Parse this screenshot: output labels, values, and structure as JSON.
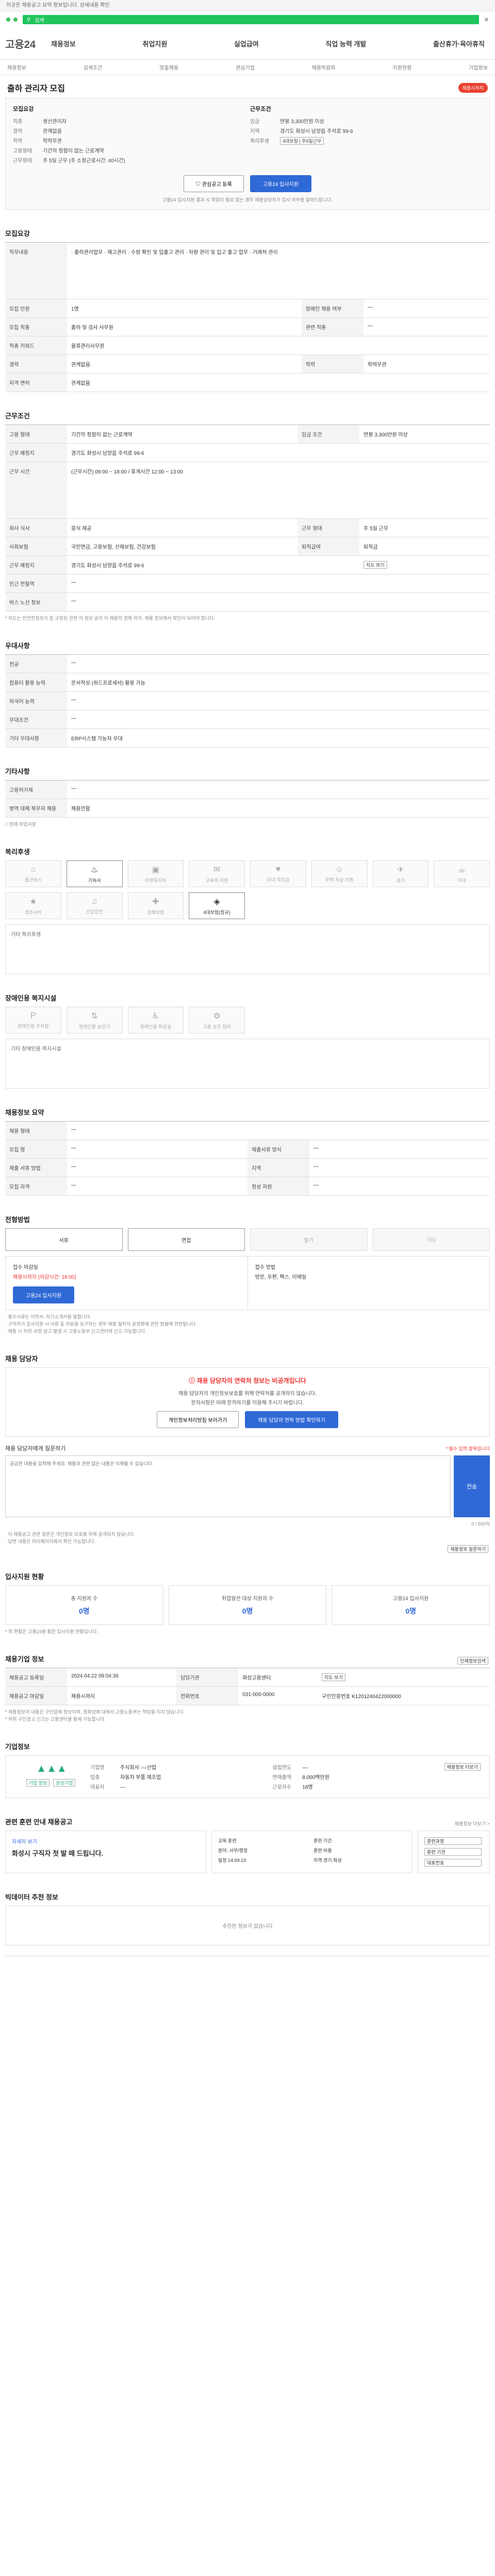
{
  "topbar": {
    "notice": "이곳은 채용공고 요약 정보입니다. 상세내용 확인"
  },
  "search": {
    "label": "검색",
    "close": "✕"
  },
  "header": {
    "logo": "고용24",
    "nav": [
      "채용정보",
      "취업지원",
      "실업급여",
      "직업 능력 개발",
      "출산휴가·육아휴직"
    ]
  },
  "subnav": [
    "채용정보",
    "검색조건",
    "맞춤채용",
    "관심기업",
    "채용박람회",
    "지원현황",
    "기업정보"
  ],
  "job": {
    "title": "출하 관리자 모집",
    "badge": "채용시까지",
    "left_title": "모집요강",
    "left": [
      {
        "k": "직종",
        "v": "생산관리자"
      },
      {
        "k": "경력",
        "v": "관계없음"
      },
      {
        "k": "학력",
        "v": "학력무관"
      },
      {
        "k": "고용형태",
        "v": "기간의 정함이 없는 근로계약"
      },
      {
        "k": "근무형태",
        "v": "주 5일 근무 (주 소정근로시간: 40시간)"
      }
    ],
    "right_title": "근무조건",
    "right": [
      {
        "k": "임금",
        "v": "연봉 3,300만원 이상"
      },
      {
        "k": "지역",
        "v": "경기도 화성시 남양읍 주석로 99-6"
      },
      {
        "k": "복리후생",
        "v": "4대보험 | 주5일근무"
      }
    ],
    "btn_interest": "관심공고 등록",
    "btn_apply": "고용24 입사지원",
    "apply_note": "고용24 입사지원 결과 시 학업이 필요 없는 경우 채용담당자가 입사 여부를 알려드립니다."
  },
  "s1": {
    "title": "모집요강",
    "rows": [
      {
        "k": "직무내용",
        "v": "· 출하관리업무 · 재고관리 · 수량 확인 및 입출고 관리 · 차량 관리 및 입고 출고 업무 · 거래처 관리"
      },
      {
        "k": "모집 인원",
        "v": "1명",
        "k2": "장애인 채용 여부",
        "v2": "—"
      },
      {
        "k": "모집 직종",
        "v": "출하 및 검사 사무원",
        "k2": "관련 직종",
        "v2": "—"
      },
      {
        "k": "직종 키워드",
        "v": "물류관리사무원"
      },
      {
        "k": "경력",
        "v": "관계없음",
        "k2": "학력",
        "v2": "학력무관"
      },
      {
        "k": "자격 면허",
        "v": "관계없음"
      }
    ]
  },
  "s2": {
    "title": "근무조건",
    "rows": [
      {
        "k": "고용 형태",
        "v": "기간의 정함이 없는 근로계약",
        "k2": "임금 조건",
        "v2": "연봉 3,300만원 이상"
      },
      {
        "k": "근무 예정지",
        "v": "경기도 화성시 남양읍 주석로 99-6"
      },
      {
        "k": "근무 시간",
        "v": "(근무시간) 09:00 ~ 18:00 / 휴게시간 12:00 ~ 13:00"
      },
      {
        "k": "회사 식사",
        "v": "중식 제공",
        "k2": "근무 형태",
        "v2": "주 5일 근무"
      },
      {
        "k": "사회보험",
        "v": "국민연금, 고용보험, 산재보험, 건강보험",
        "k2": "퇴직급여",
        "v2": "퇴직금"
      },
      {
        "k": "근무 예정지",
        "v": "경기도 화성시 남양읍 주석로 99-6",
        "k2": "",
        "v2": "지도 보기"
      },
      {
        "k": "인근 전철역",
        "v": "—"
      },
      {
        "k": "버스 노선 정보",
        "v": "—"
      }
    ],
    "note": "* 지도는 안전한정보가 첨 규정된 관련 의 정보 공지 이 채용의 정확 위치, 채용 정보에서 확인이 되어야 합니다."
  },
  "s3": {
    "title": "우대사항",
    "rows": [
      {
        "k": "전공",
        "v": "—"
      },
      {
        "k": "컴퓨터 활용 능력",
        "v": "문서작성 (워드프로세서) 활용 가능"
      },
      {
        "k": "외국어 능력",
        "v": "—"
      },
      {
        "k": "우대조건",
        "v": "—"
      },
      {
        "k": "기타 우대사항",
        "v": "ERP시스템 가능자 우대"
      }
    ]
  },
  "s4": {
    "title": "기타사항",
    "rows": [
      {
        "k": "고용허가제",
        "v": "—"
      },
      {
        "k": "병역 대체 복무자 채용",
        "v": "채용안함"
      }
    ],
    "note": "□ 장애 취업사항"
  },
  "s5": {
    "title": "복리후생",
    "items": [
      {
        "icon": "⌂",
        "label": "통근버스",
        "on": false
      },
      {
        "icon": "♨",
        "label": "기숙사",
        "on": true
      },
      {
        "icon": "▣",
        "label": "차량유지비",
        "on": false
      },
      {
        "icon": "✉",
        "label": "교육비 지원",
        "on": false
      },
      {
        "icon": "♥",
        "label": "자녀 학자금",
        "on": false
      },
      {
        "icon": "☺",
        "label": "주택 자금 지원",
        "on": false
      },
      {
        "icon": "✈",
        "label": "휴가",
        "on": false
      },
      {
        "icon": "☕",
        "label": "식대",
        "on": false
      },
      {
        "icon": "★",
        "label": "경조사비",
        "on": false
      },
      {
        "icon": "♫",
        "label": "건강검진",
        "on": false
      },
      {
        "icon": "✚",
        "label": "상해보험",
        "on": false
      },
      {
        "icon": "◈",
        "label": "4대보험(정규)",
        "on": true
      }
    ],
    "other_title": "기타 복리후생"
  },
  "s6": {
    "title": "장애인용 복지시설",
    "items": [
      "장애인용 주차장",
      "장애인용 승강기",
      "장애인용 화장실",
      "고용 보조 장비"
    ],
    "other": "기타 장애인용 복지시설"
  },
  "s7": {
    "title": "채용정보 요약",
    "rows": [
      {
        "k": "채용 형태",
        "v": "—"
      },
      {
        "k": "모집 형",
        "v": "—",
        "k2": "제출서류 양식",
        "v2": "—"
      },
      {
        "k": "제출 서류 방법",
        "v": "—",
        "k2": "지역",
        "v2": "—"
      },
      {
        "k": "모집 자격",
        "v": "—",
        "k2": "정상 자원",
        "v2": "—"
      }
    ]
  },
  "s8": {
    "title": "전형방법",
    "methods": [
      {
        "label": "서류",
        "on": true
      },
      {
        "label": "면접",
        "on": true
      },
      {
        "label": "필기",
        "on": false
      },
      {
        "label": "기타",
        "on": false
      }
    ],
    "apply1": "접수 마감일",
    "apply1v": "채용시까지 (마감시간: 18:00)",
    "apply2": "접수 방법",
    "apply2v": "방문, 우편, 팩스, 이메일",
    "apply_btn": "고용24 입사지원",
    "notes": [
      "· 필수서류는 이력서, 자기소개서를 말합니다.",
      "· 구직자가 입사지원 시 서류 등 자료를 요구하는 경우 채용 절차의 공정화에 관한 법률에 위반됩니다.",
      "· 채용 시 허위·과장 광고 발생 시 고용노동부 신고센터에 신고 가능합니다."
    ]
  },
  "s9": {
    "title": "채용 담당자",
    "warn": "채용 담당자의 연락처 정보는 비공개입니다",
    "lines": [
      "채용 담당자의 개인정보보호를 위해 연락처를 공개하지 않습니다.",
      "문의사항은 아래 문의하기를 이용해 주시기 바랍니다."
    ],
    "btn1": "개인정보처리방침 보러가기",
    "btn2": "채용 담당자 연락 방법 확인하기",
    "q_title": "채용 담당자에게 질문하기",
    "q_hint": "* 필수 입력 항목입니다",
    "q_placeholder": "궁금한 내용을 입력해 주세요. 채용과 관련 없는 내용은 삭제될 수 있습니다.",
    "q_count": "0 / 500자",
    "q_btn": "전송",
    "q_notes": [
      "· 이 채용공고 관련 질문은 개인정보 보호를 위해 공개되지 않습니다.",
      "· 답변 내용은 마이페이지에서 확인 가능합니다."
    ],
    "q_link": "채용정보 질문하기"
  },
  "s10": {
    "title": "입사지원 현황",
    "stats": [
      {
        "k": "총 지원자 수",
        "v": "0명"
      },
      {
        "k": "취업알선 대상 지원자 수",
        "v": "0명"
      },
      {
        "k": "고용24 입사지원",
        "v": "0명"
      }
    ],
    "note": "* 위 현황은 고용24를 통한 입사지원 현황입니다."
  },
  "s11": {
    "title": "채용기업 정보",
    "link": "인재정보검색",
    "rows": [
      {
        "k": "채용공고 등록일",
        "v": "2024.04.22 09:04:36",
        "k2": "담당기관",
        "v2": "화성고용센터",
        "k3": "",
        "v3": "지도 보기"
      },
      {
        "k": "채용공고 마감일",
        "v": "채용시까지",
        "k2": "전화번호",
        "v2": "031-000-0000",
        "k3": "구인인증번호",
        "v3": "K1201240422000000"
      }
    ],
    "notes": [
      "* 채용정보의 내용은 구인업체 정보이며, 정확성에 대해서 고용노동부는 책임을 지지 않습니다.",
      "* 허위 구인광고 신고는 고용센터를 통해 가능합니다."
    ]
  },
  "s12": {
    "title": "기업정보",
    "logo": "▲▲▲",
    "btn_a": "기업 정보",
    "btn_b": "관심기업",
    "info": [
      {
        "k": "기업명",
        "v": "주식회사 ○○산업"
      },
      {
        "k": "업종",
        "v": "자동차 부품 제조업"
      },
      {
        "k": "대표자",
        "v": "—"
      },
      {
        "k": "설립연도",
        "v": "—"
      },
      {
        "k": "연매출액",
        "v": "8,000백만원"
      },
      {
        "k": "근로자수",
        "v": "18명"
      }
    ],
    "map_btn": "채용정보 더보기"
  },
  "s13": {
    "title": "관련 훈련 안내 채용공고",
    "more": "채용정보 더보기 >",
    "card_title": "화성시 구직자 첫 발 떼 드립니다.",
    "card_sub": "자세히 보기",
    "kw": [
      "교육 훈련",
      "훈련 기간",
      "분야: 사무/행정",
      "훈련 비용",
      "일정 24.09.19",
      "지역 경기 화성"
    ],
    "side": [
      "훈련과정",
      "훈련 기관",
      "대표번호"
    ]
  },
  "s14": {
    "title": "빅데이터 추천 정보",
    "empty": "추천된 정보가 없습니다"
  }
}
